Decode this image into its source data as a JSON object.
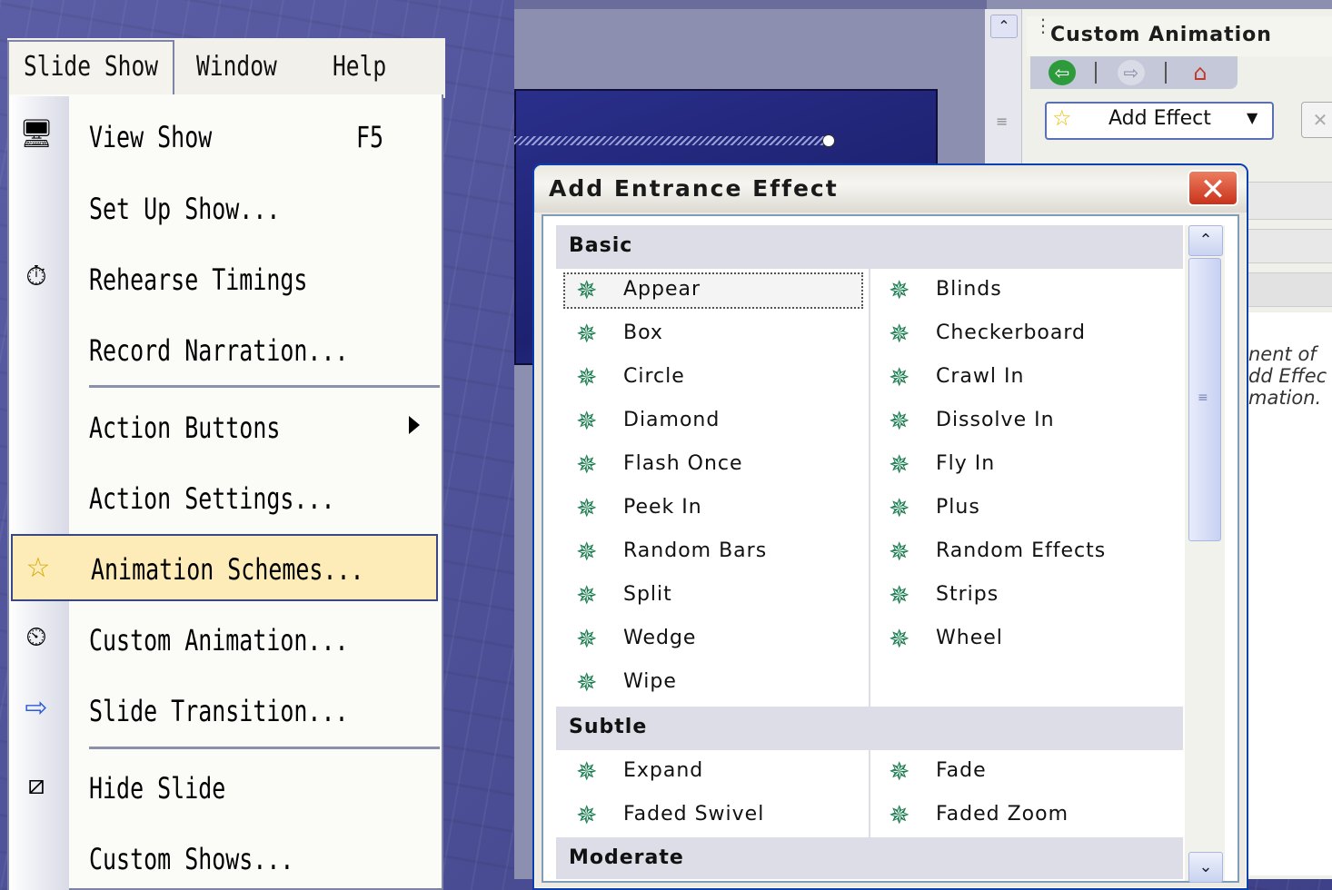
{
  "menubar": {
    "items": [
      "Slide Show",
      "Window",
      "Help"
    ]
  },
  "slideshow_menu": {
    "items": [
      {
        "label": "View Show",
        "shortcut": "F5",
        "icon": "projector-icon"
      },
      {
        "label": "Set Up Show...",
        "shortcut": "",
        "icon": ""
      },
      {
        "label": "Rehearse Timings",
        "shortcut": "",
        "icon": "stopwatch-icon"
      },
      {
        "label": "Record Narration...",
        "shortcut": "",
        "icon": ""
      },
      {
        "label": "Action Buttons",
        "shortcut": "",
        "icon": "",
        "submenu": true
      },
      {
        "label": "Action Settings...",
        "shortcut": "",
        "icon": ""
      },
      {
        "label": "Animation Schemes...",
        "shortcut": "",
        "icon": "animation-schemes-icon",
        "highlighted": true
      },
      {
        "label": "Custom Animation...",
        "shortcut": "",
        "icon": "custom-animation-icon"
      },
      {
        "label": "Slide Transition...",
        "shortcut": "",
        "icon": "slide-transition-icon"
      },
      {
        "label": "Hide Slide",
        "shortcut": "",
        "icon": "hide-slide-icon"
      },
      {
        "label": "Custom Shows...",
        "shortcut": "",
        "icon": ""
      }
    ]
  },
  "task_pane": {
    "title": "Custom Animation",
    "add_effect_label": "Add Effect",
    "hint_lines": [
      "nent of",
      "dd Effec",
      "mation."
    ]
  },
  "dialog": {
    "title": "Add Entrance Effect",
    "groups": [
      {
        "name": "Basic",
        "effects": [
          "Appear",
          "Blinds",
          "Box",
          "Checkerboard",
          "Circle",
          "Crawl In",
          "Diamond",
          "Dissolve In",
          "Flash Once",
          "Fly In",
          "Peek In",
          "Plus",
          "Random Bars",
          "Random Effects",
          "Split",
          "Strips",
          "Wedge",
          "Wheel",
          "Wipe"
        ]
      },
      {
        "name": "Subtle",
        "effects": [
          "Expand",
          "Fade",
          "Faded Swivel",
          "Faded Zoom"
        ]
      },
      {
        "name": "Moderate",
        "effects": []
      }
    ],
    "selected_effect": "Appear"
  },
  "colors": {
    "highlight": "#fdebb8",
    "title_blue": "#0a3fb0",
    "close_red": "#c9321b",
    "effect_icon_green": "#1b7c50"
  }
}
